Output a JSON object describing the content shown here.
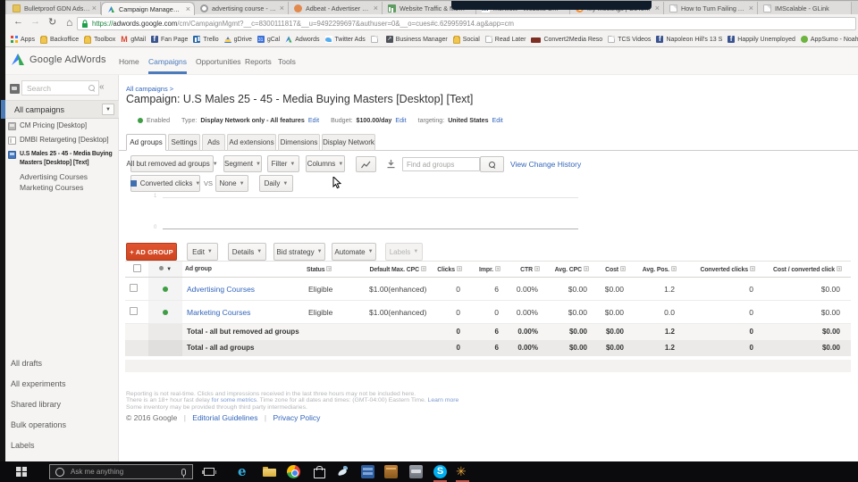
{
  "colors": {
    "adwords_link_blue": "#3366bb",
    "nav_active_blue": "#4b7bbb",
    "enabled_green": "#3f9e44",
    "add_button_red": "#d64a26",
    "taskbar_black": "#0b0b0d",
    "url_secure_green": "#168039"
  },
  "browser": {
    "tabs": [
      {
        "title": "Bulletproof GDN Ads Ski",
        "icon": "folder-icon",
        "active": false
      },
      {
        "title": "Campaign Management",
        "icon": "adwords-icon",
        "active": true
      },
      {
        "title": "advertising course - relat",
        "icon": "circle-icon",
        "active": false
      },
      {
        "title": "Adbeat - Advertiser Profi",
        "icon": "adbeat-icon",
        "active": false
      },
      {
        "title": "Website Traffic & Mobile",
        "icon": "chart-icon",
        "active": false
      },
      {
        "title": "morwolit - Website Stre",
        "icon": "m-letter-icon",
        "active": false
      },
      {
        "title": "My meetings | GoToMee",
        "icon": "gotomeeting-icon",
        "active": false
      },
      {
        "title": "How to Turn Failing Ad C",
        "icon": "page-icon",
        "active": false
      },
      {
        "title": "IMScalable - GLink",
        "icon": "page-icon",
        "active": false
      }
    ],
    "close_glyph": "×",
    "url": {
      "scheme": "https://",
      "host": "adwords.google.com",
      "path": "/cm/CampaignMgmt?__c=8300111817&__u=9492299697&authuser=0&__o=cues#c.629959914.ag&app=cm"
    },
    "bookmarks": [
      {
        "label": "Apps",
        "icon": "apps-grid-icon"
      },
      {
        "label": "Backoffice",
        "icon": "folder-icon"
      },
      {
        "label": "Toolbox",
        "icon": "folder-icon"
      },
      {
        "label": "gMail",
        "icon": "gmail-icon"
      },
      {
        "label": "Fan Page",
        "icon": "facebook-icon"
      },
      {
        "label": "Trello",
        "icon": "trello-icon"
      },
      {
        "label": "gDrive",
        "icon": "gdrive-icon"
      },
      {
        "label": "gCal",
        "icon": "gcal-icon"
      },
      {
        "label": "Adwords",
        "icon": "adwords-icon"
      },
      {
        "label": "Twitter Ads",
        "icon": "twitter-icon"
      },
      {
        "label": "",
        "icon": "page-icon"
      },
      {
        "label": "Business Manager",
        "icon": "business-manager-icon"
      },
      {
        "label": "Social",
        "icon": "folder-icon"
      },
      {
        "label": "Read Later",
        "icon": "page-icon"
      },
      {
        "label": "Convert2Media Reso",
        "icon": "c2m-icon"
      },
      {
        "label": "TCS Videos",
        "icon": "page-icon"
      },
      {
        "label": "Napoleon Hill's 13 S",
        "icon": "facebook-icon"
      },
      {
        "label": "Happily Unemployed",
        "icon": "facebook-icon"
      },
      {
        "label": "AppSumo - Noah Ka",
        "icon": "appsumo-icon"
      }
    ]
  },
  "adwords": {
    "logo_text": "Google AdWords",
    "nav": {
      "home": "Home",
      "campaigns": "Campaigns",
      "opportunities": "Opportunities",
      "reports": "Reports",
      "tools": "Tools"
    },
    "sidebar": {
      "search_placeholder": "Search",
      "collapse_glyph": "«",
      "all_campaigns": "All campaigns",
      "dropdown_glyph": "▼",
      "campaigns": [
        {
          "name": "CM Pricing [Desktop]"
        },
        {
          "name": "DMBI Retargeting [Desktop]"
        },
        {
          "name": "U.S Males 25 - 45 - Media Buying Masters [Desktop] [Text]"
        }
      ],
      "ad_groups": [
        "Advertising Courses",
        "Marketing Courses"
      ],
      "links": [
        "All drafts",
        "All experiments",
        "Shared library",
        "Bulk operations",
        "Labels"
      ]
    },
    "main": {
      "breadcrumb": "All campaigns >",
      "title": "Campaign: U.S Males 25 - 45 - Media Buying Masters [Desktop] [Text]",
      "status": {
        "enabled": "Enabled",
        "type_label": "Type:",
        "type_value": "Display Network only - All features",
        "budget_label": "Budget:",
        "budget_value": "$100.00/day",
        "targeting_label": "targeting:",
        "targeting_value": "United States",
        "edit": "Edit"
      },
      "tabs": [
        "Ad groups",
        "Settings",
        "Ads",
        "Ad extensions",
        "Dimensions",
        "Display Network"
      ],
      "toolbar": {
        "scope": "All but removed ad groups",
        "segment": "Segment",
        "filter": "Filter",
        "columns": "Columns",
        "find_placeholder": "Find ad groups",
        "history_link": "View Change History",
        "caret": "▼"
      },
      "compare": {
        "metric": "Converted clicks",
        "vs": "VS",
        "right": "None",
        "interval": "Daily"
      },
      "chart": {
        "y_top": "1",
        "y_bottom": "0"
      },
      "actions": {
        "add": "+ AD GROUP",
        "edit": "Edit",
        "details": "Details",
        "bid": "Bid strategy",
        "automate": "Automate",
        "labels": "Labels"
      },
      "table": {
        "help_glyph": "?",
        "sort_glyph": "▼",
        "columns": {
          "ad_group": "Ad group",
          "status": "Status",
          "max_cpc": "Default Max. CPC",
          "clicks": "Clicks",
          "impr": "Impr.",
          "ctr": "CTR",
          "avg_cpc": "Avg. CPC",
          "cost": "Cost",
          "avg_pos": "Avg. Pos.",
          "conv_clicks": "Converted clicks",
          "cost_conv": "Cost / converted click"
        },
        "rows": [
          {
            "name": "Advertising Courses",
            "status": "Eligible",
            "max_cpc": "$1.00(enhanced)",
            "clicks": "0",
            "impr": "6",
            "ctr": "0.00%",
            "avg_cpc": "$0.00",
            "cost": "$0.00",
            "avg_pos": "1.2",
            "conv_clicks": "0",
            "cost_conv": "$0.00"
          },
          {
            "name": "Marketing Courses",
            "status": "Eligible",
            "max_cpc": "$1.00(enhanced)",
            "clicks": "0",
            "impr": "0",
            "ctr": "0.00%",
            "avg_cpc": "$0.00",
            "cost": "$0.00",
            "avg_pos": "0.0",
            "conv_clicks": "0",
            "cost_conv": "$0.00"
          }
        ],
        "totals": [
          {
            "label": "Total - all but removed ad groups",
            "clicks": "0",
            "impr": "6",
            "ctr": "0.00%",
            "avg_cpc": "$0.00",
            "cost": "$0.00",
            "avg_pos": "1.2",
            "conv_clicks": "0",
            "cost_conv": "$0.00"
          },
          {
            "label": "Total - all ad groups",
            "clicks": "0",
            "impr": "6",
            "ctr": "0.00%",
            "avg_cpc": "$0.00",
            "cost": "$0.00",
            "avg_pos": "1.2",
            "conv_clicks": "0",
            "cost_conv": "$0.00"
          }
        ]
      },
      "footnotes": {
        "line1": "Reporting is not real-time. Clicks and impressions received in the last three hours may not be included here.",
        "line2_pre": "There is an 18+ hour fast delay ",
        "line2_link": "for some metrics",
        "line2_mid": ". Time zone for all dates and times: (GMT-04:00) Eastern Time. ",
        "line2_link2": "Learn more",
        "line3": "Some inventory may be provided through third party intermediaries."
      },
      "copyright": {
        "text": "© 2016 Google",
        "sep": "|",
        "editorial": "Editorial Guidelines",
        "privacy": "Privacy Policy"
      }
    }
  },
  "taskbar": {
    "search_placeholder": "Ask me anything"
  }
}
